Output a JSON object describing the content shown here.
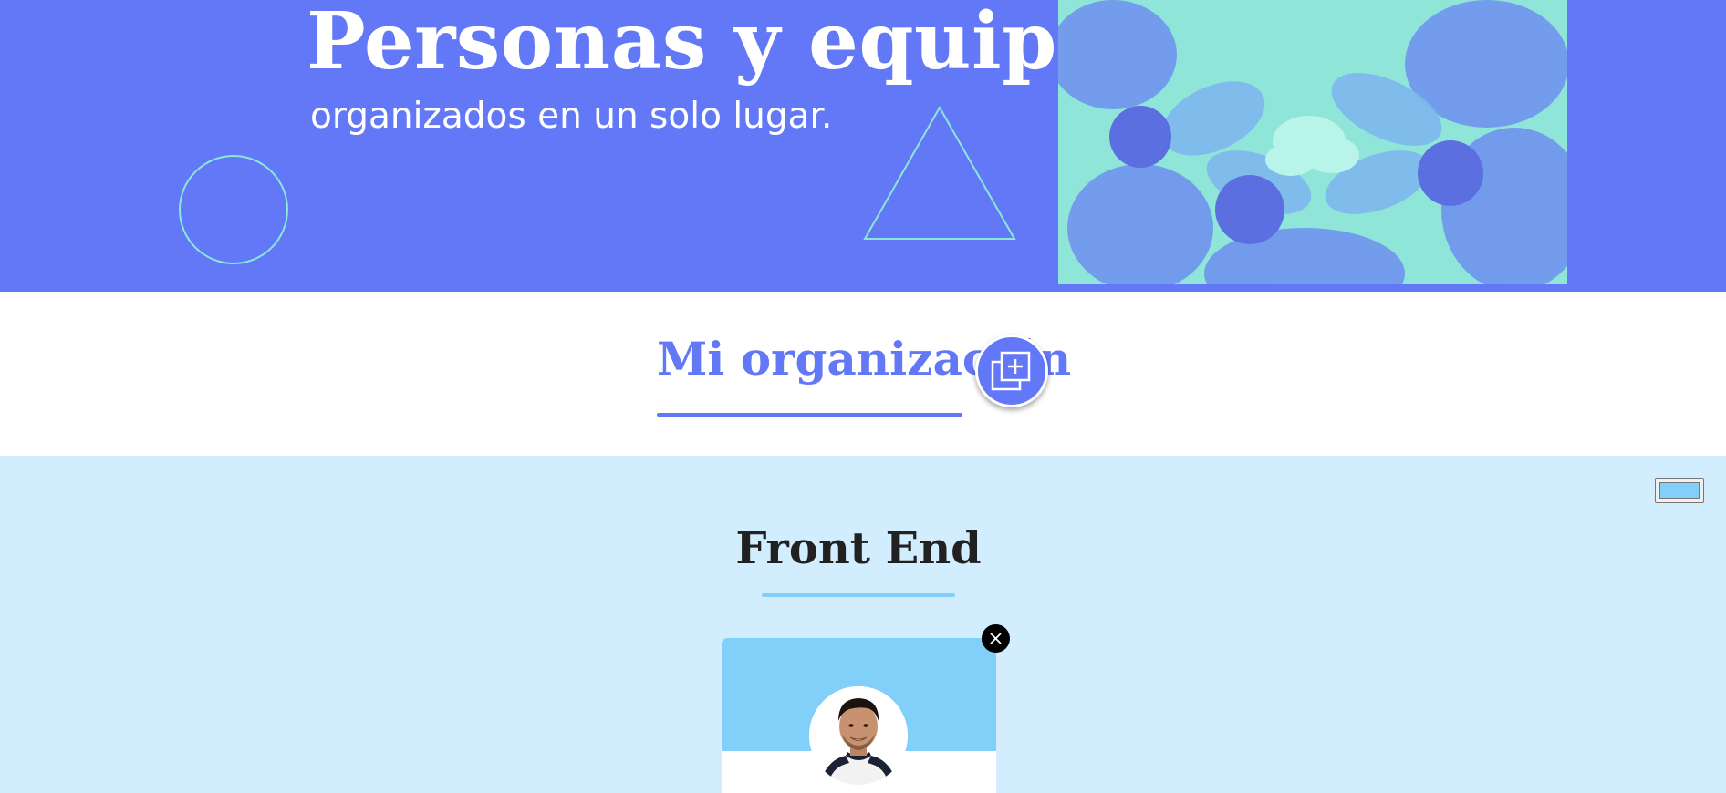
{
  "header": {
    "title": "Personas y equipos",
    "subtitle": "organizados en un solo lugar."
  },
  "organization": {
    "title": "Mi organización",
    "add_button_icon": "add-copy-icon"
  },
  "team": {
    "name": "Front End",
    "primary_color": "#82cffa",
    "secondary_color": "#d2edfe",
    "members": [
      {
        "photo_icon": "avatar-photo"
      }
    ]
  },
  "colors": {
    "brand": "#6278f7",
    "accent": "#8ae8d8"
  }
}
